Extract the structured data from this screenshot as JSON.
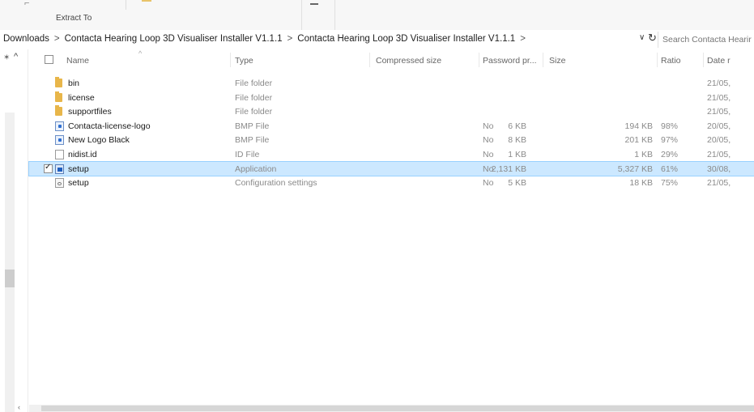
{
  "ribbon": {
    "extract_label": "Extract To"
  },
  "address": {
    "path": [
      "Downloads",
      "Contacta Hearing Loop 3D Visualiser Installer V1.1.1",
      "Contacta Hearing Loop 3D Visualiser Installer V1.1.1"
    ],
    "separator": ">",
    "trailing_separator": ">",
    "dropdown_glyph": "∨",
    "refresh_glyph": "↻",
    "search_placeholder": "Search Contacta Hearir"
  },
  "columns": {
    "name": "Name",
    "type": "Type",
    "compressed_size": "Compressed size",
    "password": "Password pr...",
    "size": "Size",
    "ratio": "Ratio",
    "date": "Date r"
  },
  "files": [
    {
      "name": "bin",
      "icon": "folder-icon",
      "type": "File folder",
      "compressed": "",
      "password": "",
      "size": "",
      "ratio": "",
      "date": "21/05,",
      "selected": false
    },
    {
      "name": "license",
      "icon": "folder-icon",
      "type": "File folder",
      "compressed": "",
      "password": "",
      "size": "",
      "ratio": "",
      "date": "21/05,",
      "selected": false
    },
    {
      "name": "supportfiles",
      "icon": "folder-icon",
      "type": "File folder",
      "compressed": "",
      "password": "",
      "size": "",
      "ratio": "",
      "date": "21/05,",
      "selected": false
    },
    {
      "name": "Contacta-license-logo",
      "icon": "bmp-file-icon",
      "type": "BMP File",
      "compressed": "6 KB",
      "password": "No",
      "size": "194 KB",
      "ratio": "98%",
      "date": "20/05,",
      "selected": false
    },
    {
      "name": "New Logo Black",
      "icon": "bmp-file-icon",
      "type": "BMP File",
      "compressed": "8 KB",
      "password": "No",
      "size": "201 KB",
      "ratio": "97%",
      "date": "20/05,",
      "selected": false
    },
    {
      "name": "nidist.id",
      "icon": "file-icon",
      "type": "ID File",
      "compressed": "1 KB",
      "password": "No",
      "size": "1 KB",
      "ratio": "29%",
      "date": "21/05,",
      "selected": false
    },
    {
      "name": "setup",
      "icon": "application-icon",
      "type": "Application",
      "compressed": "2,131 KB",
      "password": "No",
      "size": "5,327 KB",
      "ratio": "61%",
      "date": "30/08,",
      "selected": true
    },
    {
      "name": "setup",
      "icon": "config-file-icon",
      "type": "Configuration settings",
      "compressed": "5 KB",
      "password": "No",
      "size": "18 KB",
      "ratio": "75%",
      "date": "21/05,",
      "selected": false
    }
  ],
  "colors": {
    "selection": "#cce8ff",
    "selection_border": "#99d1ff",
    "folder": "#e8b64a"
  }
}
